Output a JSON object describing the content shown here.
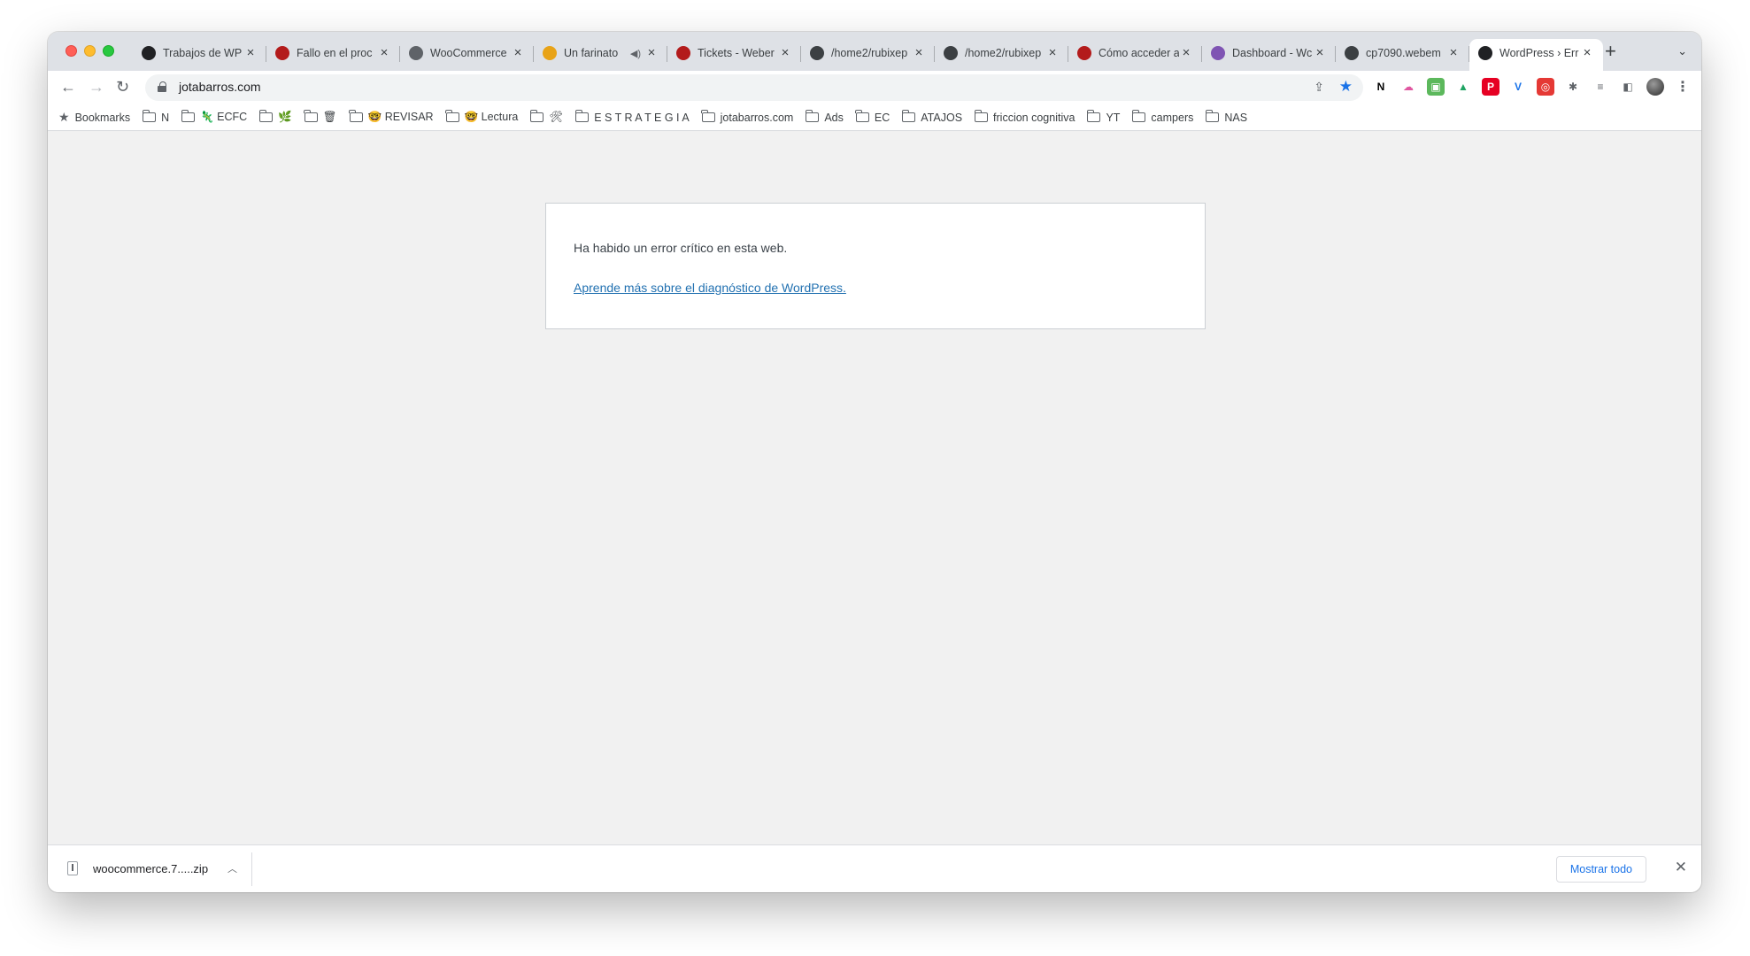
{
  "browser": {
    "tabs": [
      {
        "title": "Trabajos de WP",
        "favicon": "wp-checkered-icon",
        "color": "#202124",
        "active": false
      },
      {
        "title": "Fallo en el proc",
        "favicon": "webempresa-icon",
        "color": "#b31b1b",
        "active": false
      },
      {
        "title": "WooCommerce",
        "favicon": "wordpress-icon",
        "color": "#5f6368",
        "active": false
      },
      {
        "title": "Un farinato",
        "favicon": "farinato-icon",
        "color": "#e8a317",
        "active": false,
        "muted": true
      },
      {
        "title": "Tickets - Weber",
        "favicon": "webempresa-icon",
        "color": "#b31b1b",
        "active": false
      },
      {
        "title": "/home2/rubixep",
        "favicon": "wordpress-icon",
        "color": "#3c4043",
        "active": false
      },
      {
        "title": "/home2/rubixep",
        "favicon": "wordpress-icon",
        "color": "#3c4043",
        "active": false
      },
      {
        "title": "Cómo acceder a",
        "favicon": "webempresa-icon",
        "color": "#b31b1b",
        "active": false
      },
      {
        "title": "Dashboard - Wc",
        "favicon": "woo-icon",
        "color": "#7f54b3",
        "active": false
      },
      {
        "title": "cp7090.webem",
        "favicon": "wordpress-icon",
        "color": "#3c4043",
        "active": false
      },
      {
        "title": "WordPress › Err",
        "favicon": "wp-checkered-icon",
        "color": "#202124",
        "active": true
      }
    ],
    "new_tab": "+",
    "url": "jotabarros.com",
    "bookmarks": [
      {
        "label": "Bookmarks",
        "icon": "star-icon"
      },
      {
        "label": "N",
        "icon": "folder-icon"
      },
      {
        "label": "🦎 ECFC",
        "icon": "folder-icon"
      },
      {
        "label": "🌿",
        "icon": "folder-icon"
      },
      {
        "label": "🗑",
        "icon": "folder-icon"
      },
      {
        "label": "🤓 REVISAR",
        "icon": "folder-icon"
      },
      {
        "label": "🤓 Lectura",
        "icon": "folder-icon"
      },
      {
        "label": "🛠",
        "icon": "folder-icon"
      },
      {
        "label": "E S T R A T E G I A",
        "icon": "folder-icon"
      },
      {
        "label": "jotabarros.com",
        "icon": "folder-icon"
      },
      {
        "label": "Ads",
        "icon": "folder-icon"
      },
      {
        "label": "EC",
        "icon": "folder-icon"
      },
      {
        "label": "ATAJOS",
        "icon": "folder-icon"
      },
      {
        "label": "friccion cognitiva",
        "icon": "folder-icon"
      },
      {
        "label": "YT",
        "icon": "folder-icon"
      },
      {
        "label": "campers",
        "icon": "folder-icon"
      },
      {
        "label": "NAS",
        "icon": "folder-icon"
      }
    ],
    "extensions": [
      {
        "name": "notion-icon",
        "glyph": "N",
        "bg": "#ffffff",
        "fg": "#000000"
      },
      {
        "name": "cloud-icon",
        "glyph": "☁",
        "bg": "#ffffff",
        "fg": "#e056a0"
      },
      {
        "name": "green-ext-icon",
        "glyph": "▣",
        "bg": "#5cb85c",
        "fg": "#ffffff"
      },
      {
        "name": "drive-icon",
        "glyph": "▲",
        "bg": "#ffffff",
        "fg": "#1fa463"
      },
      {
        "name": "pinterest-icon",
        "glyph": "P",
        "bg": "#e60023",
        "fg": "#ffffff"
      },
      {
        "name": "vimeo-icon",
        "glyph": "V",
        "bg": "#ffffff",
        "fg": "#1a73e8"
      },
      {
        "name": "red-ext-icon",
        "glyph": "◎",
        "bg": "#e53935",
        "fg": "#ffffff"
      },
      {
        "name": "puzzle-icon",
        "glyph": "✱",
        "bg": "#ffffff",
        "fg": "#5f6368"
      },
      {
        "name": "reading-list-icon",
        "glyph": "≡",
        "bg": "#ffffff",
        "fg": "#5f6368"
      },
      {
        "name": "side-panel-icon",
        "glyph": "◧",
        "bg": "#ffffff",
        "fg": "#5f6368"
      }
    ]
  },
  "page": {
    "error_message": "Ha habido un error crítico en esta web.",
    "link_text": "Aprende más sobre el diagnóstico de WordPress."
  },
  "download_shelf": {
    "file_name": "woocommerce.7.....zip",
    "show_all_label": "Mostrar todo"
  }
}
